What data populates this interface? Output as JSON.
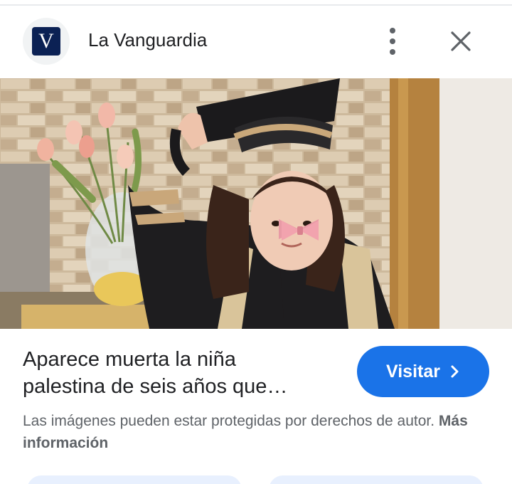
{
  "header": {
    "site_logo_letter": "V",
    "site_name": "La Vanguardia",
    "more_icon": "more-vert-icon",
    "close_icon": "close-icon"
  },
  "image": {
    "lens_icon": "google-lens-icon"
  },
  "result": {
    "title_line1": "Aparece muerta la niña",
    "title_line2": "palestina de seis años que…",
    "visit_label": "Visitar",
    "visit_icon": "chevron-right-icon"
  },
  "notice": {
    "text": "Las imágenes pueden estar protegidas por derechos de autor. ",
    "link": "Más información"
  },
  "colors": {
    "accent": "#1a73e8",
    "logo_bg": "#0b2154",
    "text_primary": "#202124",
    "text_secondary": "#5f6368",
    "chip_bg": "#e8f0fe"
  }
}
